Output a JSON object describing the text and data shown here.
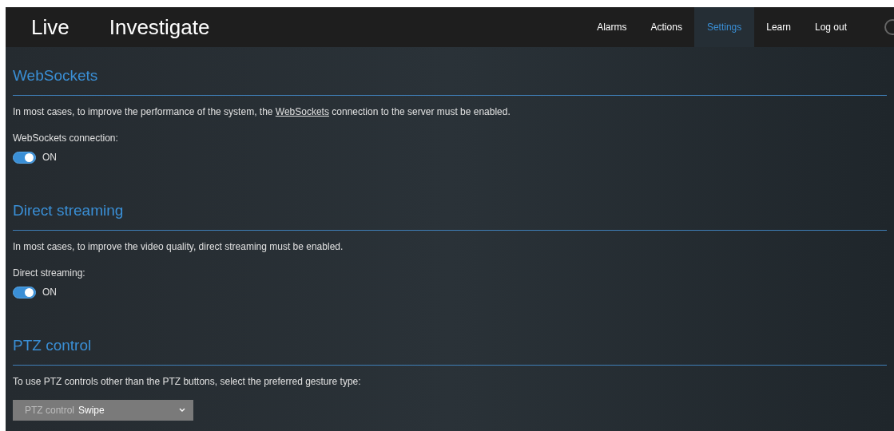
{
  "header": {
    "main_tabs": [
      {
        "label": "Live",
        "selected": false
      },
      {
        "label": "Investigate",
        "selected": false
      }
    ],
    "nav": [
      {
        "label": "Alarms",
        "selected": false
      },
      {
        "label": "Actions",
        "selected": false
      },
      {
        "label": "Settings",
        "selected": true
      },
      {
        "label": "Learn",
        "selected": false
      },
      {
        "label": "Log out",
        "selected": false
      }
    ]
  },
  "sections": [
    {
      "title": "WebSockets",
      "description": {
        "before": "In most cases, to improve the performance of the system, the ",
        "link": "WebSockets",
        "after": " connection to the server must be enabled."
      },
      "control": {
        "kind": "toggle",
        "label": "WebSockets connection:",
        "on": true,
        "state_text": "ON"
      }
    },
    {
      "title": "Direct streaming",
      "description": {
        "before": "In most cases, to improve the video quality, direct streaming must be enabled."
      },
      "control": {
        "kind": "toggle",
        "label": "Direct streaming:",
        "on": true,
        "state_text": "ON"
      }
    },
    {
      "title": "PTZ control",
      "description": {
        "before": "To use PTZ controls other than the PTZ buttons, select the preferred gesture type:"
      },
      "control": {
        "kind": "select",
        "label": "PTZ control",
        "value": "Swipe"
      }
    }
  ]
}
